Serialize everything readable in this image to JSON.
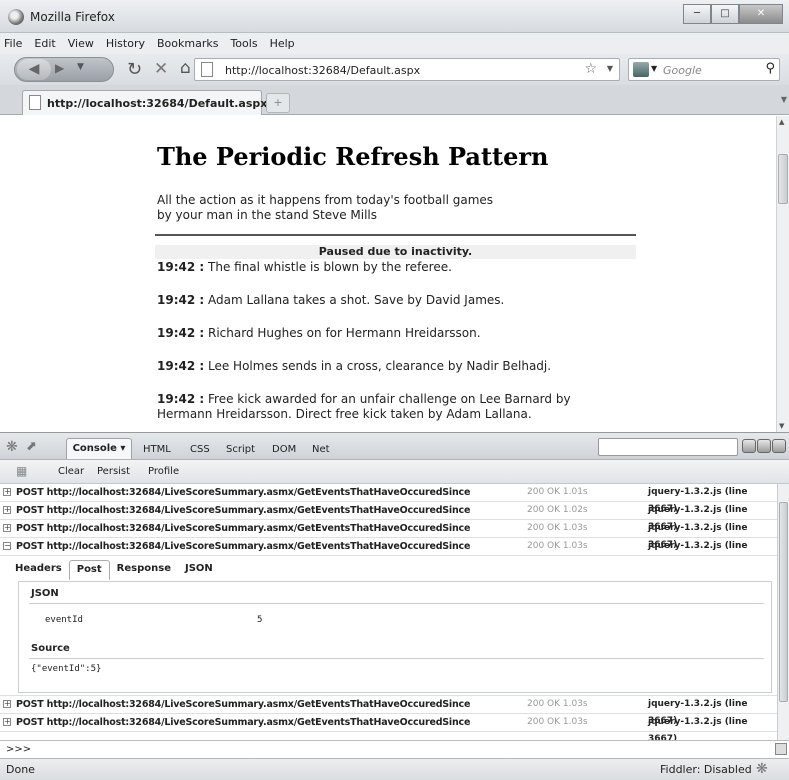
{
  "window": {
    "title": "Mozilla Firefox"
  },
  "menu": [
    "File",
    "Edit",
    "View",
    "History",
    "Bookmarks",
    "Tools",
    "Help"
  ],
  "nav": {
    "url": "http://localhost:32684/Default.aspx",
    "search_placeholder": "Google"
  },
  "tab": {
    "label": "http://localhost:32684/Default.aspx",
    "new_tab": "+"
  },
  "page": {
    "title": "The Periodic Refresh Pattern",
    "intro_line1": "All the action as it happens from today's football games",
    "intro_line2": "by your man in the stand Steve Mills",
    "paused": "Paused due to inactivity.",
    "events": [
      {
        "time": "19:42 :",
        "text": " The final whistle is blown by the referee."
      },
      {
        "time": "19:42 :",
        "text": " Adam Lallana takes a shot. Save by David James."
      },
      {
        "time": "19:42 :",
        "text": " Richard Hughes on for Hermann Hreidarsson."
      },
      {
        "time": "19:42 :",
        "text": " Lee Holmes sends in a cross, clearance by Nadir Belhadj."
      },
      {
        "time": "19:42 :",
        "text": " Free kick awarded for an unfair challenge on Lee Barnard by Hermann Hreidarsson. Direct free kick taken by Adam Lallana."
      }
    ]
  },
  "firebug": {
    "tabs": {
      "console": "Console ▾",
      "html": "HTML",
      "css": "CSS",
      "script": "Script",
      "dom": "DOM",
      "net": "Net"
    },
    "sub": {
      "clear": "Clear",
      "persist": "Persist",
      "profile": "Profile"
    },
    "requests": [
      {
        "text": "POST http://localhost:32684/LiveScoreSummary.asmx/GetEventsThatHaveOccuredSince",
        "status": "200 OK 1.01s",
        "source": "jquery-1.3.2.js (line 3667)",
        "expanded": false
      },
      {
        "text": "POST http://localhost:32684/LiveScoreSummary.asmx/GetEventsThatHaveOccuredSince",
        "status": "200 OK 1.02s",
        "source": "jquery-1.3.2.js (line 3667)",
        "expanded": false
      },
      {
        "text": "POST http://localhost:32684/LiveScoreSummary.asmx/GetEventsThatHaveOccuredSince",
        "status": "200 OK 1.03s",
        "source": "jquery-1.3.2.js (line 3667)",
        "expanded": false
      },
      {
        "text": "POST http://localhost:32684/LiveScoreSummary.asmx/GetEventsThatHaveOccuredSince",
        "status": "200 OK 1.03s",
        "source": "jquery-1.3.2.js (line 3667)",
        "expanded": true
      }
    ],
    "requests_after": [
      {
        "text": "POST http://localhost:32684/LiveScoreSummary.asmx/GetEventsThatHaveOccuredSince",
        "status": "200 OK 1.03s",
        "source": "jquery-1.3.2.js (line 3667)"
      },
      {
        "text": "POST http://localhost:32684/LiveScoreSummary.asmx/GetEventsThatHaveOccuredSince",
        "status": "200 OK 1.03s",
        "source": "jquery-1.3.2.js (line 3667)"
      }
    ],
    "detail": {
      "tabs": [
        "Headers",
        "Post",
        "Response",
        "JSON"
      ],
      "active_tab": "Post",
      "json_heading": "JSON",
      "param_name": "eventId",
      "param_value": "5",
      "source_heading": "Source",
      "source_value": "{\"eventId\":5}"
    },
    "prompt": ">>>"
  },
  "status": {
    "text": "Done",
    "fiddler": "Fiddler: Disabled"
  }
}
